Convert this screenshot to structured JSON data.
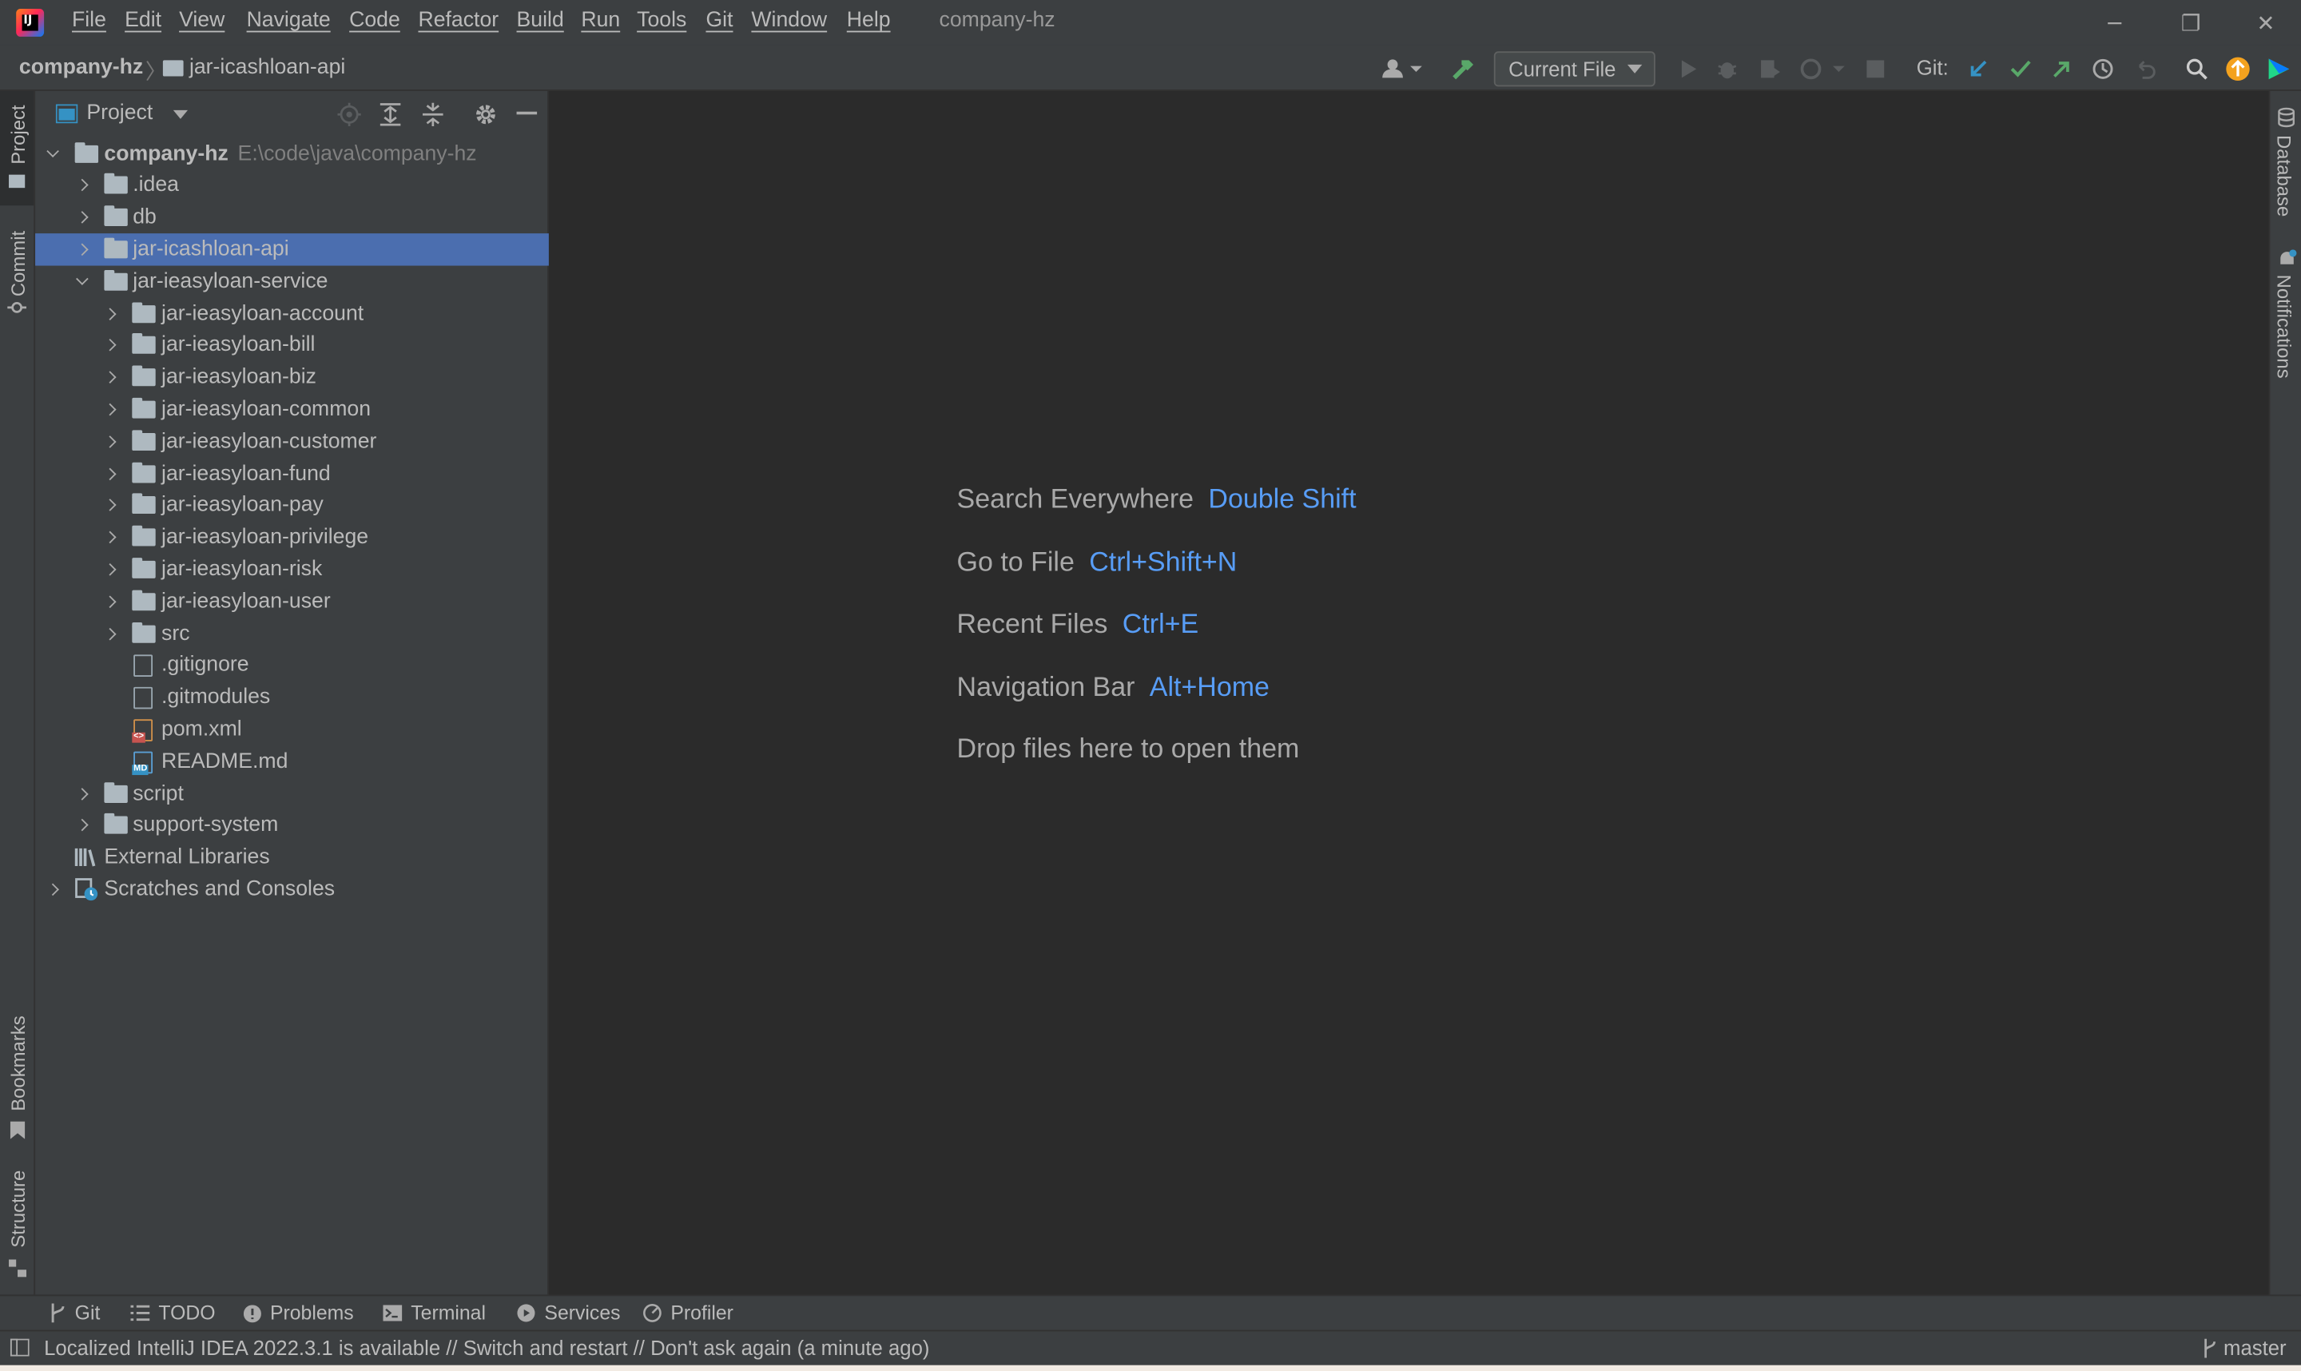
{
  "titlebar": {
    "window_title": "company-hz",
    "menu": [
      "File",
      "Edit",
      "View",
      "Navigate",
      "Code",
      "Refactor",
      "Build",
      "Run",
      "Tools",
      "Git",
      "Window",
      "Help"
    ],
    "controls": {
      "minimize": "─",
      "restore": "❐",
      "close": "✕"
    }
  },
  "navbar": {
    "breadcrumb": [
      "company-hz",
      "jar-icashloan-api"
    ],
    "run_config": "Current File",
    "git_label": "Git:",
    "icons": [
      "user-icon",
      "build-hammer-icon",
      "run-icon",
      "debug-icon",
      "coverage-icon",
      "profile-icon",
      "stop-icon",
      "git-update-icon",
      "git-commit-icon",
      "git-push-icon",
      "history-icon",
      "rollback-icon",
      "search-icon",
      "update-icon",
      "toolbox-icon"
    ]
  },
  "left_strip": {
    "tabs": [
      "Project",
      "Commit",
      "Bookmarks",
      "Structure"
    ]
  },
  "right_strip": {
    "tabs": [
      "Database",
      "Notifications"
    ]
  },
  "project_panel": {
    "title": "Project",
    "tree": [
      {
        "label": "company-hz",
        "hint": "E:\\code\\java\\company-hz",
        "depth": 0,
        "expanded": true,
        "kind": "module",
        "bold": true
      },
      {
        "label": ".idea",
        "depth": 1,
        "expanded": false,
        "kind": "folder"
      },
      {
        "label": "db",
        "depth": 1,
        "expanded": false,
        "kind": "folder"
      },
      {
        "label": "jar-icashloan-api",
        "depth": 1,
        "expanded": false,
        "kind": "folder",
        "selected": true
      },
      {
        "label": "jar-ieasyloan-service",
        "depth": 1,
        "expanded": true,
        "kind": "folder"
      },
      {
        "label": "jar-ieasyloan-account",
        "depth": 2,
        "expanded": false,
        "kind": "folder"
      },
      {
        "label": "jar-ieasyloan-bill",
        "depth": 2,
        "expanded": false,
        "kind": "folder"
      },
      {
        "label": "jar-ieasyloan-biz",
        "depth": 2,
        "expanded": false,
        "kind": "folder"
      },
      {
        "label": "jar-ieasyloan-common",
        "depth": 2,
        "expanded": false,
        "kind": "folder"
      },
      {
        "label": "jar-ieasyloan-customer",
        "depth": 2,
        "expanded": false,
        "kind": "folder"
      },
      {
        "label": "jar-ieasyloan-fund",
        "depth": 2,
        "expanded": false,
        "kind": "folder"
      },
      {
        "label": "jar-ieasyloan-pay",
        "depth": 2,
        "expanded": false,
        "kind": "folder"
      },
      {
        "label": "jar-ieasyloan-privilege",
        "depth": 2,
        "expanded": false,
        "kind": "folder"
      },
      {
        "label": "jar-ieasyloan-risk",
        "depth": 2,
        "expanded": false,
        "kind": "folder"
      },
      {
        "label": "jar-ieasyloan-user",
        "depth": 2,
        "expanded": false,
        "kind": "folder"
      },
      {
        "label": "src",
        "depth": 2,
        "expanded": false,
        "kind": "folder"
      },
      {
        "label": ".gitignore",
        "depth": 2,
        "kind": "file"
      },
      {
        "label": ".gitmodules",
        "depth": 2,
        "kind": "file"
      },
      {
        "label": "pom.xml",
        "depth": 2,
        "kind": "xml"
      },
      {
        "label": "README.md",
        "depth": 2,
        "kind": "md"
      },
      {
        "label": "script",
        "depth": 1,
        "expanded": false,
        "kind": "folder"
      },
      {
        "label": "support-system",
        "depth": 1,
        "expanded": false,
        "kind": "folder"
      },
      {
        "label": "External Libraries",
        "depth": 0,
        "kind": "libraries"
      },
      {
        "label": "Scratches and Consoles",
        "depth": 0,
        "expanded": false,
        "kind": "scratches"
      }
    ]
  },
  "editor_hints": [
    {
      "text": "Search Everywhere",
      "shortcut": "Double Shift"
    },
    {
      "text": "Go to File",
      "shortcut": "Ctrl+Shift+N"
    },
    {
      "text": "Recent Files",
      "shortcut": "Ctrl+E"
    },
    {
      "text": "Navigation Bar",
      "shortcut": "Alt+Home"
    },
    {
      "text": "Drop files here to open them",
      "shortcut": ""
    }
  ],
  "bottom_tabs": [
    "Git",
    "TODO",
    "Problems",
    "Terminal",
    "Services",
    "Profiler"
  ],
  "statusbar": {
    "message": "Localized IntelliJ IDEA 2022.3.1 is available // Switch and restart // Don't ask again (a minute ago)",
    "branch": "master"
  },
  "colors": {
    "selection": "#4b6eaf",
    "shortcut": "#589df6",
    "panel": "#3c3f41",
    "editor": "#2b2b2b"
  }
}
